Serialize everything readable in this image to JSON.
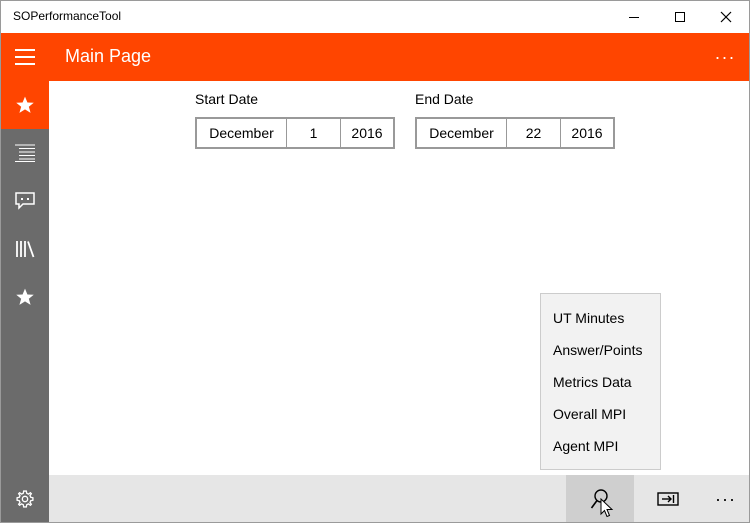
{
  "window": {
    "title": "SOPerformanceTool"
  },
  "header": {
    "title": "Main Page",
    "more_label": "···"
  },
  "nav": {
    "items": [
      {
        "icon": "star-icon",
        "active": true
      },
      {
        "icon": "list-icon",
        "active": false
      },
      {
        "icon": "chat-icon",
        "active": false
      },
      {
        "icon": "library-icon",
        "active": false
      },
      {
        "icon": "star-icon",
        "active": false
      }
    ],
    "settings_icon": "gear-icon"
  },
  "start_date": {
    "label": "Start Date",
    "month": "December",
    "day": "1",
    "year": "2016"
  },
  "end_date": {
    "label": "End Date",
    "month": "December",
    "day": "22",
    "year": "2016"
  },
  "menu": {
    "items": [
      "UT Minutes",
      "Answer/Points",
      "Metrics Data",
      "Overall MPI",
      "Agent MPI"
    ]
  },
  "command_bar": {
    "more_label": "···"
  },
  "colors": {
    "accent": "#ff4500",
    "rail": "#6b6b6b",
    "command_bar": "#e6e6e6",
    "flyout": "#f2f2f2"
  }
}
